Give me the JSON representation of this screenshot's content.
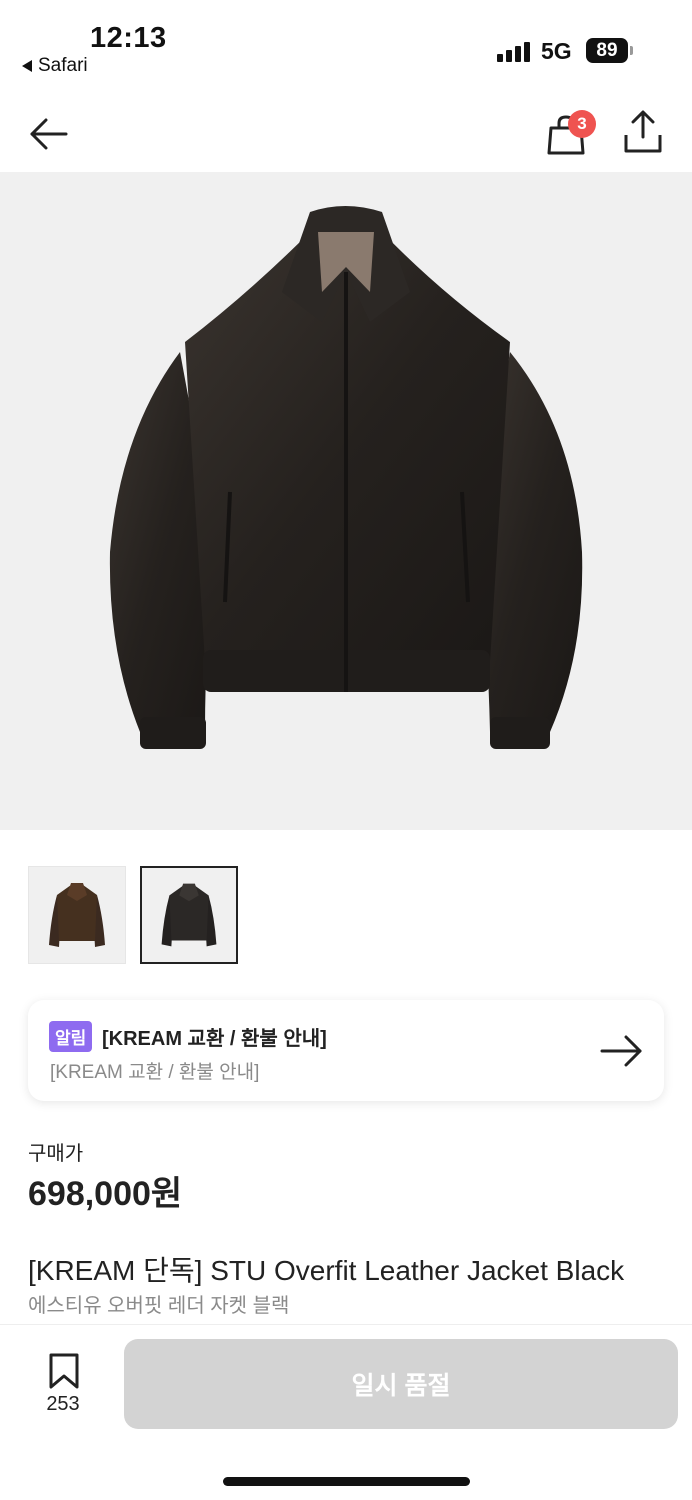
{
  "status_bar": {
    "time": "12:13",
    "back_app": "Safari",
    "network": "5G",
    "battery": "89"
  },
  "nav": {
    "cart_count": "3",
    "icons": [
      "back-arrow-icon",
      "shopping-bag-icon",
      "share-icon"
    ]
  },
  "product": {
    "image_desc_icon": "leather-jacket-image",
    "thumbnails_count": 2,
    "selected_thumbnail": 2
  },
  "notice": {
    "badge": "알림",
    "title": "[KREAM 교환 / 환불 안내]",
    "subtitle": "[KREAM 교환 / 환불 안내]"
  },
  "price": {
    "label": "구매가",
    "value": "698,000원"
  },
  "title": {
    "name": "[KREAM 단독] STU Overfit Leather Jacket Black",
    "name_ko": "에스티유 오버핏 레더 자켓 블랙"
  },
  "bottom_bar": {
    "bookmark_count": "253",
    "buy_label": "일시 품절"
  },
  "colors": {
    "badge_purple": "#8e6bf0",
    "cart_badge_red": "#ef5350",
    "disabled_button": "#d3d3d3",
    "image_bg": "#f0f0f0"
  }
}
